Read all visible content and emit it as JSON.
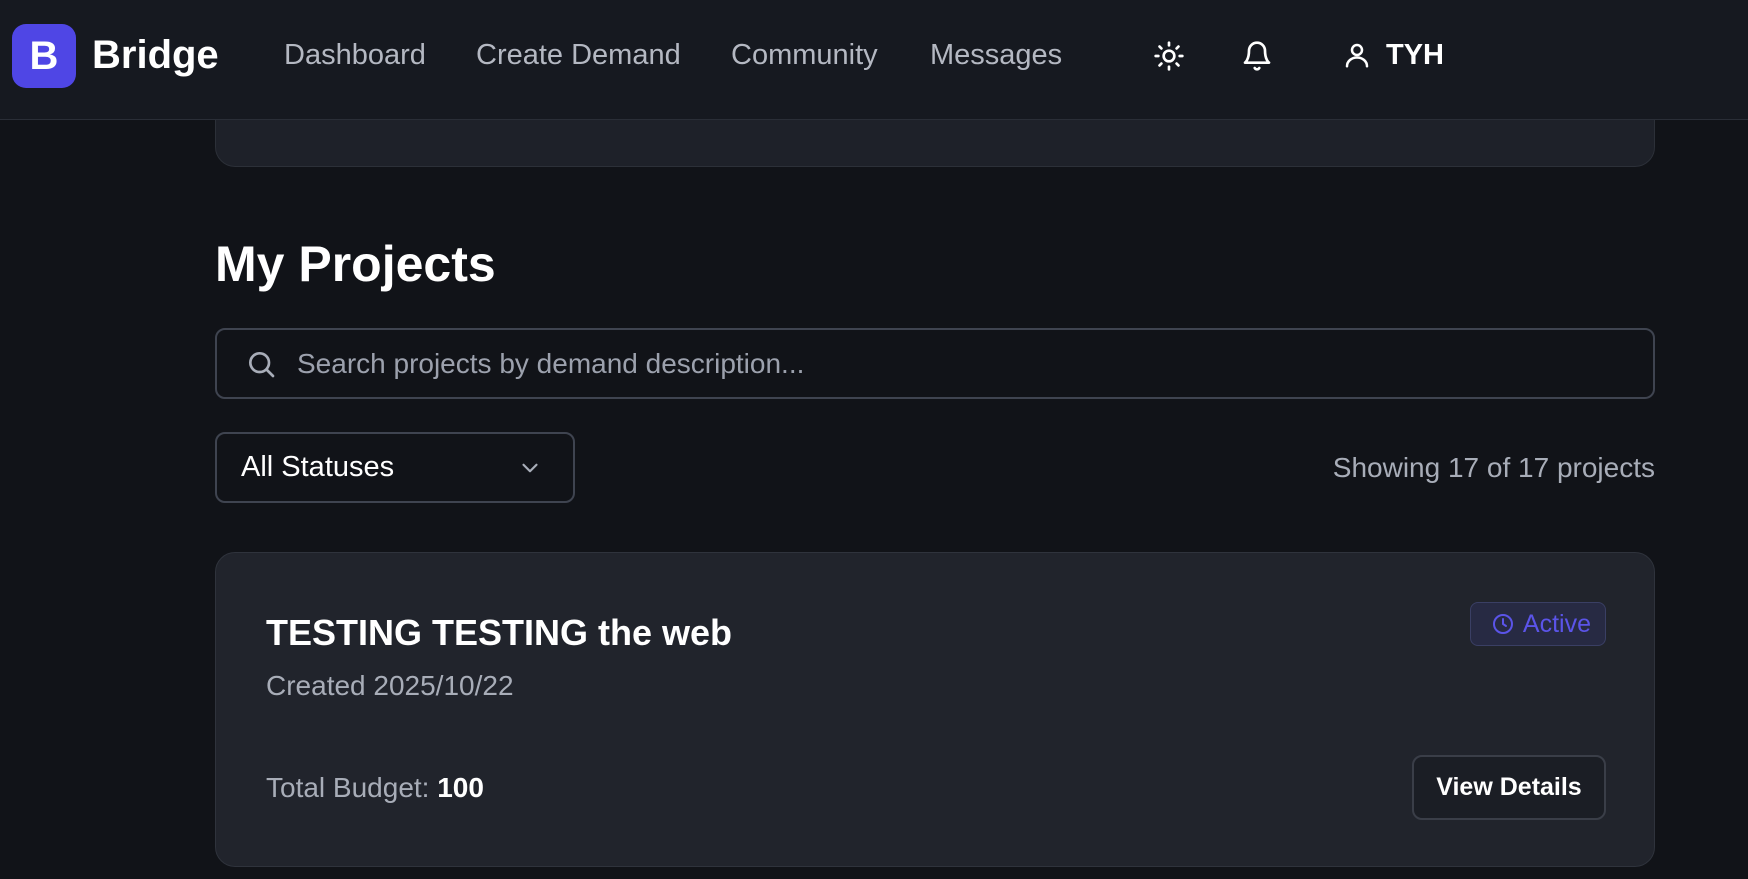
{
  "header": {
    "logo_letter": "B",
    "brand": "Bridge",
    "nav": [
      "Dashboard",
      "Create Demand",
      "Community",
      "Messages"
    ],
    "user": "TYH"
  },
  "projects": {
    "title": "My Projects",
    "search_placeholder": "Search projects by demand description...",
    "status_filter": "All Statuses",
    "showing": "Showing 17 of 17 projects"
  },
  "project_card": {
    "title": "TESTING TESTING the web",
    "created": "Created 2025/10/22",
    "status": "Active",
    "budget_label": "Total Budget:",
    "budget_value": "100",
    "view_label": "View Details"
  },
  "colors": {
    "accent": "#4f46e5",
    "background": "#111318",
    "card": "#21242c",
    "active_status": "#5b54e8"
  },
  "icons": [
    "sun-icon",
    "bell-icon",
    "user-icon",
    "search-icon",
    "chevron-down-icon",
    "clock-icon"
  ]
}
